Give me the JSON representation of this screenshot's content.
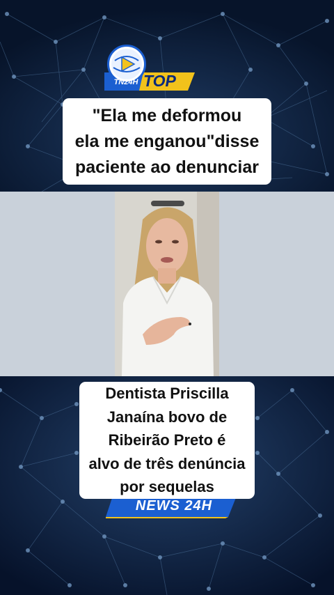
{
  "logo": {
    "top_label": "TOP",
    "channel_label": "TN24H"
  },
  "headline": {
    "lines": [
      "\"Ela me deformou",
      "ela me enganou\"disse",
      "paciente ao denunciar"
    ]
  },
  "story": {
    "lines": [
      "Dentista Priscilla",
      "Janaína bovo de",
      "Ribeirão Preto é",
      "alvo de três denúncia",
      "por sequelas"
    ]
  },
  "footer_logo": {
    "label": "NEWS 24H"
  },
  "colors": {
    "background": "#0a1a30",
    "network_lines": "#4b6f98",
    "brand_blue": "#1b5fd1",
    "brand_yellow": "#f2c21b",
    "video_band": "#c9d1da",
    "caption_bg": "#ffffff"
  }
}
